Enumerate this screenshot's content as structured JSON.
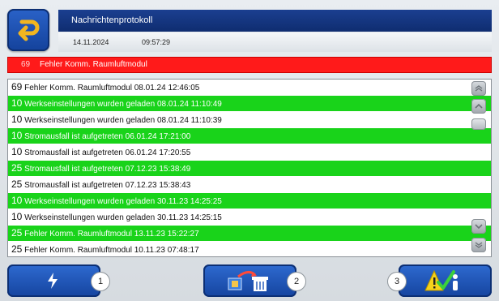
{
  "header": {
    "title": "Nachrichtenprotokoll",
    "date": "14.11.2024",
    "time": "09:57:29"
  },
  "alarm": {
    "code": "69",
    "text": "Fehler Komm. Raumluftmodul"
  },
  "messages": [
    {
      "code": "69",
      "text": "Fehler Komm. Raumluftmodul 08.01.24 12:46:05",
      "highlight": false
    },
    {
      "code": "10",
      "text": "Werkseinstellungen wurden geladen 08.01.24 11:10:49",
      "highlight": true
    },
    {
      "code": "10",
      "text": "Werkseinstellungen wurden geladen 08.01.24 11:10:39",
      "highlight": false
    },
    {
      "code": "10",
      "text": "Stromausfall ist aufgetreten 06.01.24 17:21:00",
      "highlight": true
    },
    {
      "code": "10",
      "text": "Stromausfall ist aufgetreten 06.01.24 17:20:55",
      "highlight": false
    },
    {
      "code": "25",
      "text": "Stromausfall ist aufgetreten 07.12.23 15:38:49",
      "highlight": true
    },
    {
      "code": "25",
      "text": "Stromausfall ist aufgetreten 07.12.23 15:38:43",
      "highlight": false
    },
    {
      "code": "10",
      "text": "Werkseinstellungen wurden geladen 30.11.23 14:25:25",
      "highlight": true
    },
    {
      "code": "10",
      "text": "Werkseinstellungen wurden geladen 30.11.23 14:25:15",
      "highlight": false
    },
    {
      "code": "25",
      "text": "Fehler Komm. Raumluftmodul 13.11.23 15:22:27",
      "highlight": true
    },
    {
      "code": "25",
      "text": "Fehler Komm. Raumluftmodul 10.11.23 07:48:17",
      "highlight": false
    }
  ],
  "bottom_buttons": [
    {
      "number": "1",
      "icon": "lightning-icon"
    },
    {
      "number": "2",
      "icon": "archive-delete-icon"
    },
    {
      "number": "3",
      "icon": "warning-info-icon"
    }
  ],
  "colors": {
    "highlight": "#19d31a",
    "alarm": "#ff1a1a",
    "button": "#1f55b8",
    "title_bar": "#15367f"
  }
}
